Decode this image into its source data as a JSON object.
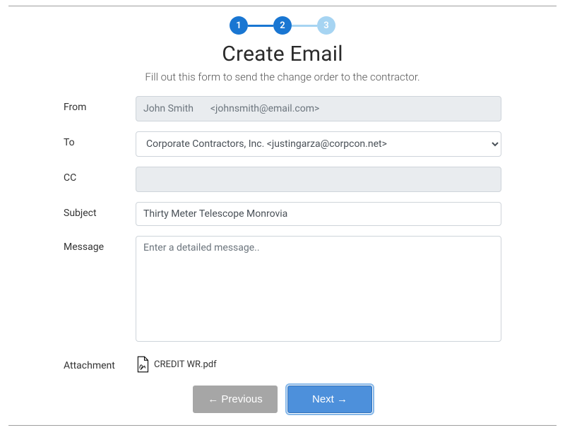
{
  "stepper": {
    "steps": [
      "1",
      "2",
      "3"
    ],
    "active_color": "#1976d2",
    "inactive_color": "#a6d4f2"
  },
  "heading": {
    "title": "Create Email",
    "subtitle": "Fill out this form to send the change order to the contractor."
  },
  "labels": {
    "from": "From",
    "to": "To",
    "cc": "CC",
    "subject": "Subject",
    "message": "Message",
    "attachment": "Attachment"
  },
  "form": {
    "from_name": "John Smith",
    "from_email": "<johnsmith@email.com>",
    "to_selected": "Corporate Contractors, Inc. <justingarza@corpcon.net>",
    "cc": "",
    "subject": "Thirty Meter Telescope Monrovia",
    "message": "",
    "message_placeholder": "Enter a detailed message..",
    "attachment_name": "CREDIT WR.pdf"
  },
  "buttons": {
    "previous": "← Previous",
    "next": "Next →"
  }
}
